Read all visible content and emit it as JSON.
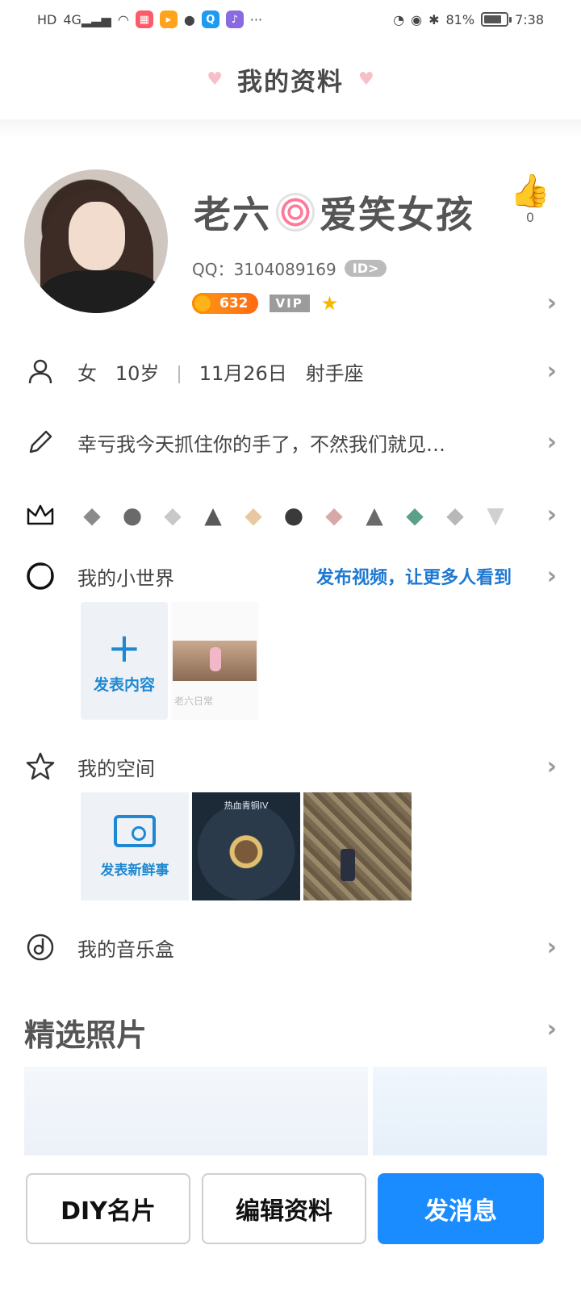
{
  "status_bar": {
    "left_icons": [
      "hd-icon",
      "4g-signal-icon",
      "wifi-icon",
      "app-icon-1",
      "app-icon-2",
      "wechat-icon",
      "qq-browser-icon",
      "music-icon",
      "more-dots-icon"
    ],
    "battery": "81%",
    "battery_level": 0.81,
    "time": "7:38"
  },
  "header": {
    "title": "我的资料"
  },
  "profile": {
    "nickname_part1": "老六",
    "nickname_part2": "爱笑女孩",
    "qq_label": "QQ：",
    "qq_number": "3104089169",
    "id_badge": "ID>",
    "coin_count": "632",
    "vip_label": "VIP",
    "like_count": "0"
  },
  "info": {
    "gender": "女",
    "age": "10岁",
    "birthday": "11月26日",
    "zodiac": "射手座",
    "signature": "幸亏我今天抓住你的手了，不然我们就见…"
  },
  "medals": [
    "medal-1",
    "medal-2",
    "medal-3",
    "medal-4",
    "medal-5",
    "medal-6",
    "medal-7",
    "medal-8",
    "medal-9",
    "medal-10",
    "medal-11"
  ],
  "world": {
    "title": "我的小世界",
    "promo_link": "发布视频，让更多人看到",
    "add_label": "发表内容",
    "video_caption": "老六日常"
  },
  "space": {
    "title": "我的空间",
    "post_label": "发表新鲜事",
    "photo_caption": "热血青铜IV"
  },
  "music": {
    "title": "我的音乐盒"
  },
  "photos": {
    "title": "精选照片"
  },
  "buttons": {
    "diy": "DIY名片",
    "edit": "编辑资料",
    "message": "发消息"
  },
  "colors": {
    "primary": "#1a8cff",
    "link": "#1e78d2",
    "coin": "#ff7a10"
  }
}
